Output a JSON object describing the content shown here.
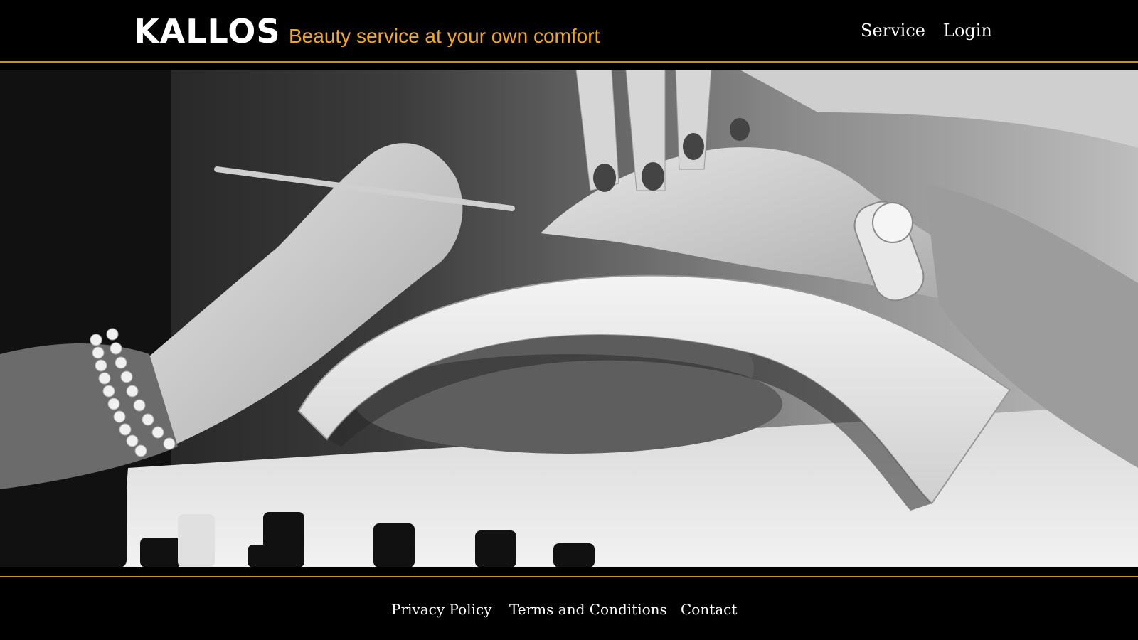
{
  "header": {
    "logo": "KALLOS",
    "tagline": "Beauty service at your own comfort",
    "nav": {
      "service": "Service",
      "login": "Login"
    }
  },
  "hero": {
    "image": "manicure-photo"
  },
  "footer": {
    "links": {
      "privacy": "Privacy Policy",
      "terms": "Terms and Conditions",
      "contact": "Contact"
    }
  },
  "colors": {
    "background": "#000000",
    "accent": "#f2a81c",
    "divider": "#c8901f",
    "text": "#ffffff"
  }
}
